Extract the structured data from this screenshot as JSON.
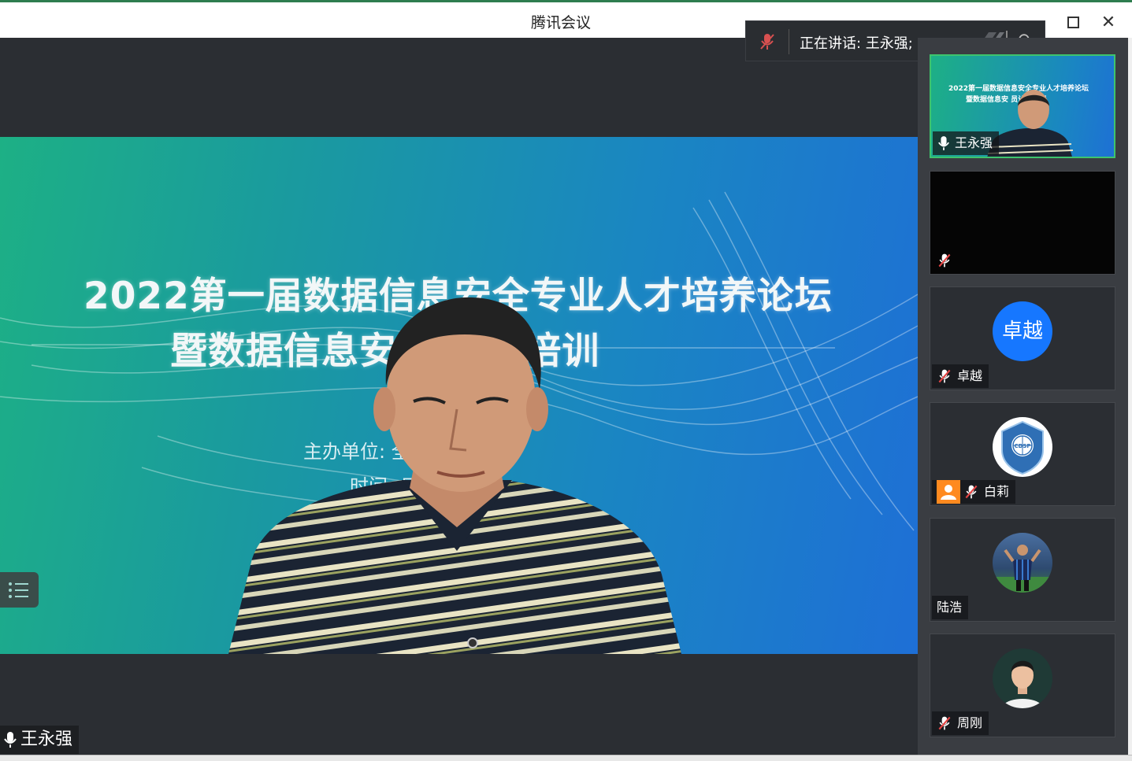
{
  "window": {
    "title": "腾讯会议",
    "maximize_icon": "maximize-icon",
    "close_icon": "close-icon",
    "close_glyph": "✕"
  },
  "speaking": {
    "text": "正在讲话: 王永强;",
    "undo_glyph": "↶"
  },
  "main_video": {
    "slide_line1": "2022第一届数据信息安全专业人才培养论坛",
    "slide_line2": "暨数据信息安              员认证培训",
    "slide_sub1": "主办单位:                            全协会",
    "slide_sub2": "时间:                          日-13日",
    "speaker_name": "王永强"
  },
  "participants": [
    {
      "name": "王永强",
      "mic": "on",
      "thumb_line1": "2022第一届数据信息安全专业人才培养论坛",
      "thumb_line2": "暨数据信息安        员认证培训"
    },
    {
      "name": "",
      "mic": "muted"
    },
    {
      "name": "卓越",
      "mic": "muted",
      "avatar_text": "卓越"
    },
    {
      "name": "白莉",
      "mic": "muted",
      "avatar_text": "CDSP"
    },
    {
      "name": "陆浩",
      "mic": "none"
    },
    {
      "name": "周刚",
      "mic": "muted"
    }
  ],
  "colors": {
    "accent_green": "#3ec46d",
    "avatar_blue": "#1677ff",
    "badge_orange": "#ff8a1f",
    "mute_red": "#e54545"
  }
}
